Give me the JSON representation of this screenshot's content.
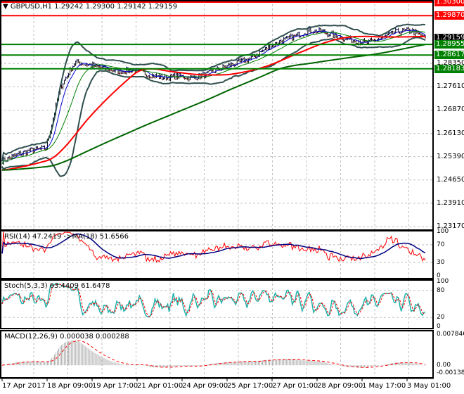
{
  "header": {
    "symbol": "GBPUSD,H1",
    "ohlc": "1.29242 1.29300 1.29142 1.29159"
  },
  "indicators": {
    "rsi": "RSI(14) 47.2419  ->MA(18) 51.6566",
    "stoch": "Stoch(5,3,3) 63.4409 61.6478",
    "macd": "MACD(12,26,9) 0.000038 0.000288"
  },
  "levels": [
    {
      "label": "1.30300",
      "value": 1.303,
      "color": "#ff0000"
    },
    {
      "label": "1.29870",
      "value": 1.2987,
      "color": "#ff0000"
    },
    {
      "label": "1.29159",
      "value": 1.29159,
      "color": "#000000"
    },
    {
      "label": "1.28955",
      "value": 1.28955,
      "color": "#008000"
    },
    {
      "label": "1.28617",
      "value": 1.28617,
      "color": "#008000"
    },
    {
      "label": "1.28183",
      "value": 1.28183,
      "color": "#008000"
    }
  ],
  "sub_axes": {
    "rsi": [
      "100",
      "70",
      "30",
      "0"
    ],
    "stoch": [
      "100",
      "80",
      "20",
      "0"
    ],
    "macd": [
      "0.007846",
      "0.00",
      "-0.001382"
    ]
  },
  "chart_data": {
    "type": "line",
    "title": "GBPUSD,H1",
    "ylim": [
      1.2317,
      1.303
    ],
    "y_ticks": [
      "1.28350",
      "1.27610",
      "1.26870",
      "1.26130",
      "1.25390",
      "1.24650",
      "1.23910",
      "1.23170"
    ],
    "x_ticks": [
      "17 Apr 2017",
      "18 Apr 09:00",
      "19 Apr 17:00",
      "21 Apr 01:00",
      "24 Apr 09:00",
      "25 Apr 17:00",
      "27 Apr 01:00",
      "28 Apr 09:00",
      "1 May 17:00",
      "3 May 01:00"
    ],
    "close_waypoints": [
      1.2525,
      1.2545,
      1.256,
      1.2565,
      1.276,
      1.284,
      1.283,
      1.282,
      1.281,
      1.2815,
      1.28,
      1.279,
      1.2795,
      1.279,
      1.28,
      1.282,
      1.2835,
      1.285,
      1.288,
      1.2905,
      1.292,
      1.294,
      1.2935,
      1.292,
      1.291,
      1.29,
      1.2915,
      1.2935,
      1.294,
      1.2916
    ],
    "grid": true
  }
}
